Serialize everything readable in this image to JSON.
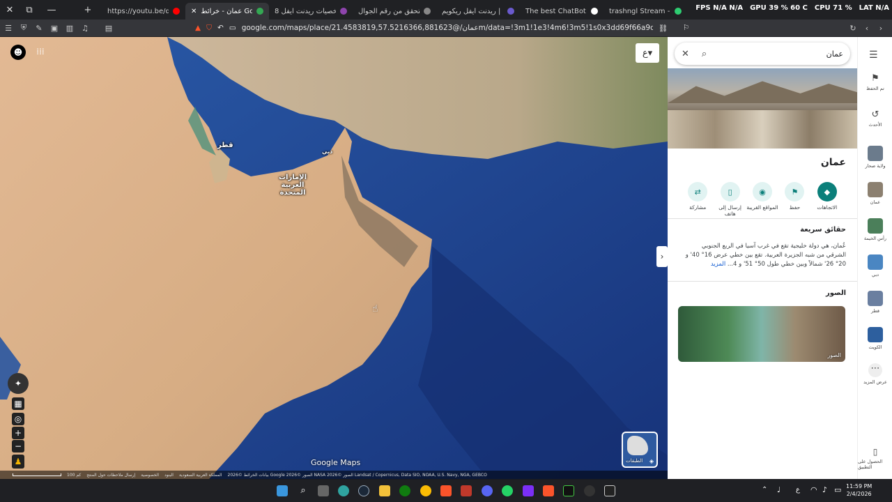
{
  "tabs": [
    {
      "label": "https://youtu.be/qtqdfv",
      "favicon_color": "#ff0000"
    },
    {
      "label": "عمان - خرائط Google",
      "favicon_color": "#34a853",
      "active": true
    },
    {
      "label": "شخصيات ريدنت ايفل 8 -",
      "favicon_color": "#8e44ad"
    },
    {
      "label": "التحقق من رقم الجوال",
      "favicon_color": "#888888"
    },
    {
      "label": "ريدنت ايفل ريكويم | NG",
      "favicon_color": "#6a5acd"
    },
    {
      "label": "The best ChatBot and W",
      "favicon_color": "#ffffff"
    },
    {
      "label": "trashngl Stream - Watch",
      "favicon_color": "#2ecc71"
    }
  ],
  "perf": {
    "fps_label": "FPS",
    "fps_value": "N/A",
    "fps_value2": "N/A",
    "gpu_label": "GPU",
    "gpu_value": "39 % 60 C",
    "cpu_label": "CPU",
    "cpu_value": "71 %",
    "lat_label": "LAT",
    "lat_value": "N/A"
  },
  "url": "google.com/maps/place/عمان/@21.4583819,57.5216366,881623m/data=!3m1!1e3!4m6!3m5!1s0x3dd69f66a9d59bbf:0x3a064c76...",
  "map": {
    "labels": {
      "qatar": "قطر",
      "uae": "الإمارات العربية المتحدة",
      "dubai": "دبي"
    },
    "attribution": "بيانات الخرائط ©2026 Google الصور ©2026 NASA الصور ©2026 Landsat / Copernicus, Data SIO, NOAA, U.S. Navy, NGA, GEBCO",
    "footer_links": [
      "المملكة العربية السعودية",
      "البنود",
      "الخصوصية",
      "إرسال ملاحظات حول المنتج"
    ],
    "scale": "100 كم",
    "logo": "Google Maps",
    "layers_label": "الطبقات",
    "language_btn": "ع"
  },
  "panel": {
    "search_value": "عمان",
    "title": "عمان",
    "actions": [
      {
        "label": "الاتجاهات",
        "icon": "directions-icon",
        "primary": true
      },
      {
        "label": "حفظ",
        "icon": "bookmark-icon"
      },
      {
        "label": "المواقع القريبة",
        "icon": "nearby-icon"
      },
      {
        "label": "إرسال إلى هاتف",
        "icon": "phone-icon"
      },
      {
        "label": "مشاركة",
        "icon": "share-icon"
      }
    ],
    "quick_facts_title": "حقائق سريعة",
    "quick_facts_text": "عُمان، هي دولة خليجية تقع في غرب آسيا في الربع الجنوبي الشرقي من شبه الجزيرة العربية. تقع بين خطي عرض 16° 40' و 20° 26' شمالاً وبين خطي طول 50° 51' و 4...",
    "more_link": "المزيد",
    "photos_title": "الصور",
    "photo_caption": "الصور"
  },
  "rail": {
    "items": [
      {
        "label": "تم الحفظ",
        "icon": "bookmark-icon"
      },
      {
        "label": "الأحدث",
        "icon": "history-icon"
      },
      {
        "label": "ولاية صحار",
        "thumb": "#6b7b8c"
      },
      {
        "label": "عمان",
        "thumb": "#8c8070"
      },
      {
        "label": "رأس الخيمة",
        "thumb": "#4b7f5a"
      },
      {
        "label": "دبي",
        "thumb": "#4a86c2"
      },
      {
        "label": "قطر",
        "thumb": "#6a7fa0"
      },
      {
        "label": "الكويت",
        "thumb": "#2d5f9e"
      },
      {
        "label": "عرض المزيد",
        "icon": "more-icon"
      }
    ],
    "get_app": "الحصول على التطبيق"
  },
  "taskbar": {
    "time": "11:59 PM",
    "date": "2/4/2026",
    "lang": "ع"
  }
}
